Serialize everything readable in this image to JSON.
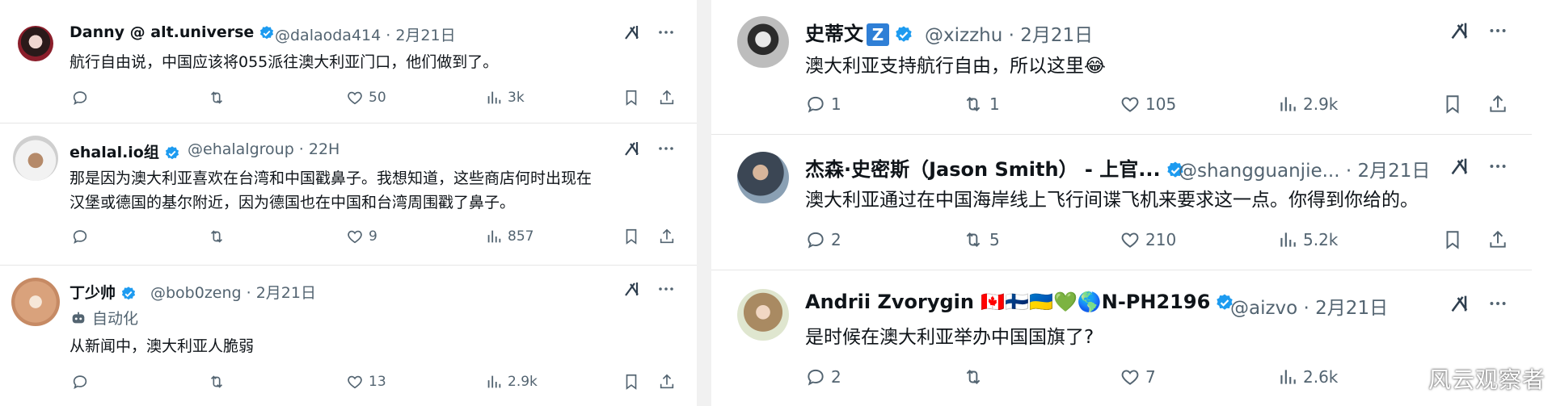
{
  "left_tweets": [
    {
      "name": "Danny @ alt.universe",
      "handle_time": "@dalaoda414 · 2月21日",
      "text": "航行自由说，中国应该将055派往澳大利亚门口，他们做到了。",
      "stats": {
        "reply": "",
        "retweet": "",
        "like": "50",
        "views": "3k"
      }
    },
    {
      "name": "ehalal.io组",
      "handle_time": "@ehalalgroup · 22H",
      "text_lines": [
        "那是因为澳大利亚喜欢在台湾和中国戳鼻子。我想知道，这些商店何时出现在",
        "汉堡或德国的基尔附近，因为德国也在中国和台湾周围戳了鼻子。"
      ],
      "stats": {
        "reply": "",
        "retweet": "",
        "like": "9",
        "views": "857"
      }
    },
    {
      "name": "丁少帅",
      "handle_time": "@bob0zeng · 2月21日",
      "automated": "自动化",
      "text": "从新闻中，澳大利亚人脆弱",
      "stats": {
        "reply": "",
        "retweet": "",
        "like": "13",
        "views": "2.9k"
      }
    }
  ],
  "right_tweets": [
    {
      "name": "史蒂文",
      "name_badge": "Z",
      "handle_time": "@xizzhu · 2月21日",
      "text": "澳大利亚支持航行自由，所以这里😂",
      "stats": {
        "reply": "1",
        "retweet": "1",
        "like": "105",
        "views": "2.9k"
      }
    },
    {
      "name": "杰森·史密斯（Jason Smith） - 上官...",
      "handle_time": "@shangguanjie... · 2月21日",
      "text": "澳大利亚通过在中国海岸线上飞行间谍飞机来要求这一点。你得到你给的。",
      "stats": {
        "reply": "2",
        "retweet": "5",
        "like": "210",
        "views": "5.2k"
      }
    },
    {
      "name": "Andrii Zvorygin 🇨🇦🇫🇮🇺🇦💚🌎N-PH2196",
      "handle_time": "@aizvo · 2月21日",
      "text": "是时候在澳大利亚举办中国国旗了?",
      "stats": {
        "reply": "2",
        "retweet": "",
        "like": "7",
        "views": "2.6k"
      }
    }
  ],
  "watermark": "风云观察者",
  "colors": {
    "verified": "#1d9bf0",
    "icon_gray": "#536471",
    "badge_blue": "#2f7fd6"
  },
  "icons": [
    "grok-icon",
    "more-icon",
    "reply-icon",
    "retweet-icon",
    "like-icon",
    "views-icon",
    "bookmark-icon",
    "share-icon",
    "verified-badge-icon",
    "robot-icon"
  ]
}
